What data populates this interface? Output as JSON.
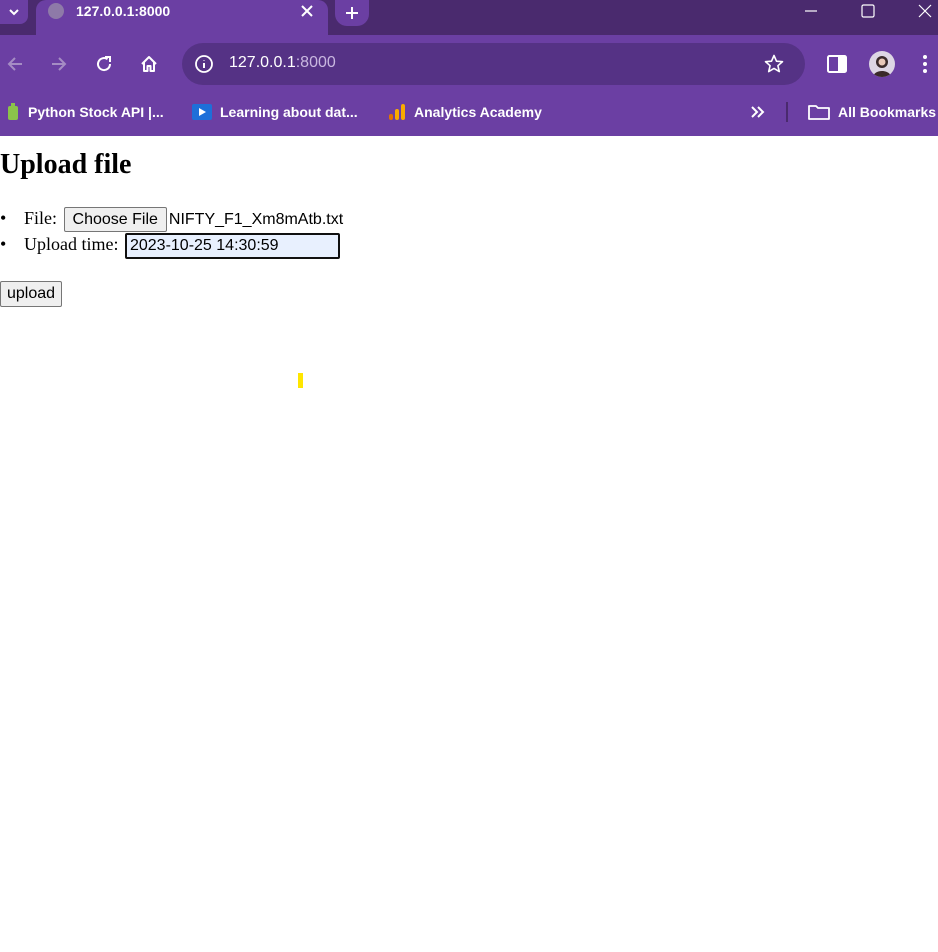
{
  "browser": {
    "tab_title": "127.0.0.1:8000",
    "url_host": "127.0.0.1",
    "url_port": ":8000",
    "bookmarks": [
      {
        "label": "Python Stock API |...",
        "icon": "bookmark-favicon-green"
      },
      {
        "label": "Learning about dat...",
        "icon": "bookmark-favicon-play"
      },
      {
        "label": "Analytics Academy",
        "icon": "analytics-icon"
      }
    ],
    "all_bookmarks_label": "All Bookmarks"
  },
  "page": {
    "heading": "Upload file",
    "file_label": "File:",
    "choose_file_label": "Choose File",
    "file_name": "NIFTY_F1_Xm8mAtb.txt",
    "time_label": "Upload time:",
    "time_value": "2023-10-25 14:30:59",
    "upload_label": "upload"
  },
  "colors": {
    "tabstrip": "#4a2a6e",
    "toolbar": "#6b3fa3",
    "omnibox": "#553285",
    "input_bg": "#e8f0fe",
    "cursor": "#ffe600"
  }
}
